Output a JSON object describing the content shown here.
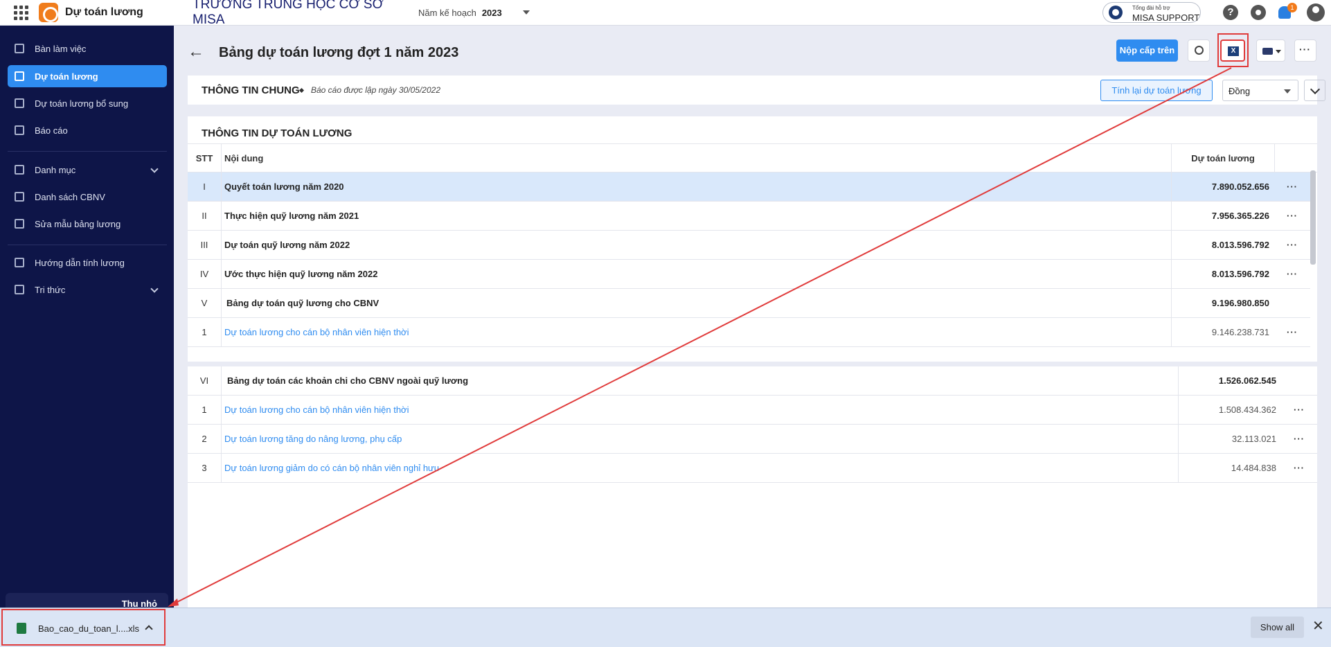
{
  "topbar": {
    "app_name": "Dự toán lương",
    "school": "TRƯỜNG TRUNG HỌC CƠ SỞ MISA",
    "plan_label": "Năm kế hoạch",
    "plan_year": "2023",
    "support_small": "Tổng đài hỗ trợ",
    "support_label": "MISA SUPPORT",
    "help": "?",
    "notification_count": "1"
  },
  "sidebar": {
    "items": [
      {
        "label": "Bàn làm việc",
        "icon": "dashboard-icon"
      },
      {
        "label": "Dự toán lương",
        "icon": "estimate-icon",
        "active": true
      },
      {
        "label": "Dự toán lương bổ sung",
        "icon": "supplement-icon"
      },
      {
        "label": "Báo cáo",
        "icon": "report-icon"
      },
      {
        "label": "Danh mục",
        "icon": "list-icon"
      },
      {
        "label": "Danh sách CBNV",
        "icon": "staff-icon"
      },
      {
        "label": "Sửa mẫu bảng lương",
        "icon": "edit-template-icon"
      },
      {
        "label": "Hướng dẫn tính lương",
        "icon": "guide-icon"
      },
      {
        "label": "Tri thức",
        "icon": "knowledge-icon"
      }
    ],
    "collapse_label": "Thu nhỏ"
  },
  "page": {
    "back": "←",
    "title": "Bảng dự toán lương đợt 1 năm 2023",
    "submit_label": "Nộp cấp trên",
    "excel_label": "X",
    "more": "···"
  },
  "info": {
    "title": "THÔNG TIN CHUNG",
    "date_note": "Báo cáo được lập ngày 30/05/2022",
    "recalc_label": "Tính lại dự toán lương",
    "unit": "Đồng"
  },
  "table": {
    "section_title": "THÔNG TIN DỰ TOÁN LƯƠNG",
    "headers": [
      "STT",
      "Nội dung",
      "Dự toán lương"
    ],
    "rows": [
      {
        "stt": "I",
        "content": "Quyết toán lương năm 2020",
        "value": "7.890.052.656",
        "menu": "···"
      },
      {
        "stt": "II",
        "content": "Thực hiện quỹ lương năm 2021",
        "value": "7.956.365.226",
        "menu": "···"
      },
      {
        "stt": "III",
        "content": "Dự toán quỹ lương năm 2022",
        "value": "8.013.596.792",
        "menu": "···"
      },
      {
        "stt": "IV",
        "content": "Ước thực hiện quỹ lương năm 2022",
        "value": "8.013.596.792",
        "menu": "···"
      },
      {
        "stt": "V",
        "content": "Bảng dự toán quỹ lương cho CBNV",
        "value": "9.196.980.850",
        "menu": ""
      },
      {
        "stt": "1",
        "content": "Dự toán lương cho cán bộ nhân viên hiện thời",
        "value": "9.146.238.731",
        "menu": "···"
      }
    ],
    "rows2": [
      {
        "stt": "VI",
        "content": "Bảng dự toán các khoản chi cho CBNV ngoài quỹ lương",
        "value": "1.526.062.545",
        "menu": ""
      },
      {
        "stt": "1",
        "content": "Dự toán lương cho cán bộ nhân viên hiện thời",
        "value": "1.508.434.362",
        "menu": "···"
      },
      {
        "stt": "2",
        "content": "Dự toán lương tăng do nâng lương, phụ cấp",
        "value": "32.113.021",
        "menu": "···"
      },
      {
        "stt": "3",
        "content": "Dự toán lương giảm do có cán bộ nhân viên nghỉ hưu",
        "value": "14.484.838",
        "menu": "···"
      }
    ]
  },
  "download": {
    "file_name": "Bao_cao_du_toan_l....xls",
    "show_all": "Show all",
    "close": "✕"
  },
  "colors": {
    "sidebar_bg": "#0e1548",
    "accent": "#2f8cf0",
    "annotation": "#e03b3b"
  }
}
